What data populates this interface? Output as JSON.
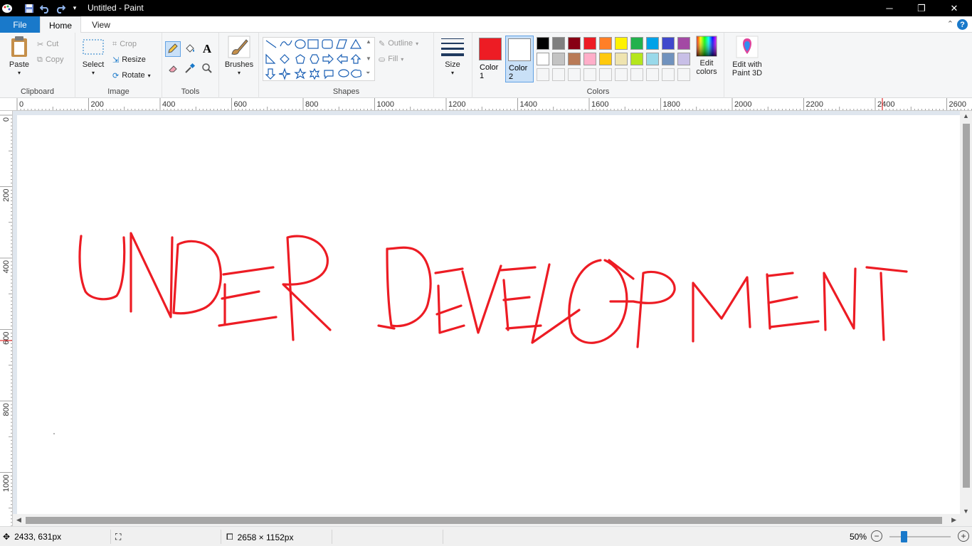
{
  "window": {
    "title": "Untitled - Paint",
    "minimize": "─",
    "maximize": "❐",
    "close": "✕"
  },
  "tabs": [
    {
      "label": "File"
    },
    {
      "label": "Home"
    },
    {
      "label": "View"
    }
  ],
  "ribbon": {
    "clipboard": {
      "label": "Clipboard",
      "paste": "Paste",
      "cut": "Cut",
      "copy": "Copy"
    },
    "image": {
      "label": "Image",
      "select": "Select",
      "crop": "Crop",
      "resize": "Resize",
      "rotate": "Rotate"
    },
    "tools": {
      "label": "Tools"
    },
    "brushes": {
      "label": "Brushes"
    },
    "shapes": {
      "label": "Shapes",
      "outline": "Outline",
      "fill": "Fill"
    },
    "size": {
      "label": "Size"
    },
    "colors": {
      "label": "Colors",
      "color1_label": "Color 1",
      "color2_label": "Color 2",
      "edit_colors": "Edit colors",
      "color1": "#ed1c24",
      "color2": "#ffffff",
      "palette_row1": [
        "#000000",
        "#7f7f7f",
        "#880015",
        "#ed1c24",
        "#ff7f27",
        "#fff200",
        "#22b14c",
        "#00a2e8",
        "#3f48cc",
        "#a349a4"
      ],
      "palette_row2": [
        "#ffffff",
        "#c3c3c3",
        "#b97a57",
        "#ffaec9",
        "#ffc90e",
        "#efe4b0",
        "#b5e61d",
        "#99d9ea",
        "#7092be",
        "#c8bfe7"
      ]
    },
    "paint3d": {
      "label": "Edit with Paint 3D"
    }
  },
  "ruler": {
    "h_labels": [
      "0",
      "200",
      "400",
      "600",
      "800",
      "1000",
      "1200",
      "1400",
      "1600",
      "1800",
      "2000",
      "2200",
      "2400",
      "2600"
    ],
    "v_labels": [
      "0",
      "200",
      "400",
      "600",
      "800",
      "1000"
    ]
  },
  "canvas": {
    "stroke_color": "#ed1c24"
  },
  "status": {
    "cursor_pos": "2433, 631px",
    "canvas_size": "2658 × 1152px",
    "zoom": "50%"
  }
}
